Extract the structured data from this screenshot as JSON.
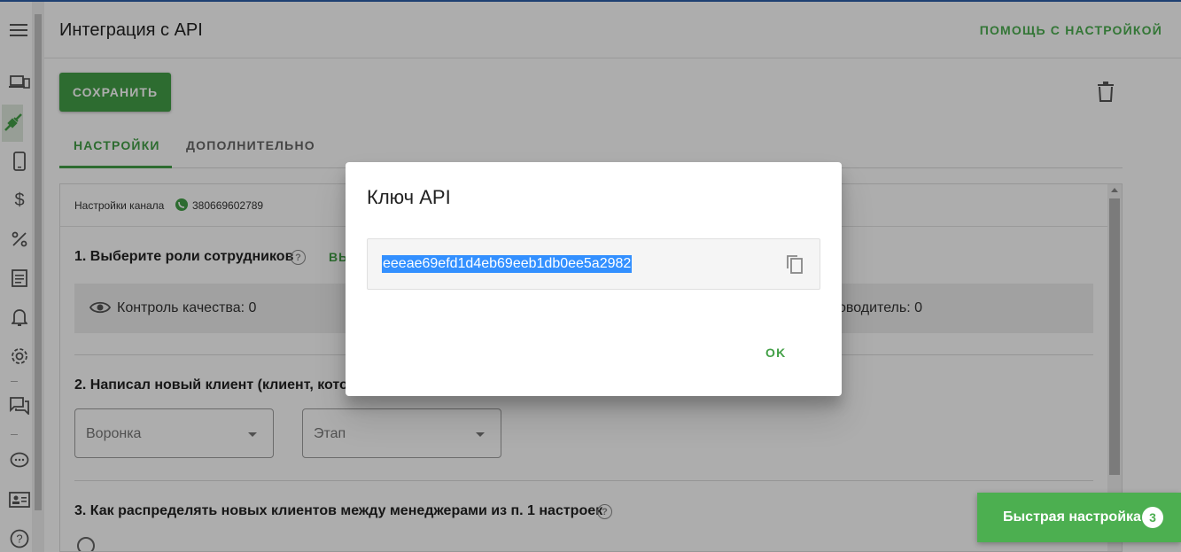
{
  "header": {
    "title": "Интеграция с API",
    "help_link": "ПОМОЩЬ С НАСТРОЙКОЙ"
  },
  "toolbar": {
    "save_label": "СОХРАНИТЬ"
  },
  "tabs": [
    {
      "label": "НАСТРОЙКИ",
      "active": true
    },
    {
      "label": "ДОПОЛНИТЕЛЬНО",
      "active": false
    }
  ],
  "panel": {
    "channel_label": "Настройки канала",
    "channel_phone": "380669602789",
    "section1_title": "1. Выберите роли сотрудников",
    "select_all": "ВЫ",
    "role_qc": "Контроль качества: 0",
    "role_mgr": "оводитель: 0",
    "section2_title": "2. Написал новый клиент (клиент, котор",
    "funnel_placeholder": "Воронка",
    "stage_placeholder": "Этап",
    "section3_title": "3. Как распределять новых клиентов между менеджерами из п. 1 настроек"
  },
  "dialog": {
    "title": "Ключ API",
    "api_key": "eeeae69efd1d4eb69eeb1db0ee5a2982",
    "ok_label": "OK"
  },
  "quick_setup": {
    "label": "Быстрая настройка",
    "badge": "3"
  },
  "colors": {
    "accent_green": "#43a047",
    "selection_blue": "#3390ff"
  },
  "sidebar": {
    "icons": [
      "menu-icon",
      "devices-icon",
      "integration-plug-icon",
      "phone-icon",
      "dollar-icon",
      "percent-icon",
      "document-icon",
      "bell-icon",
      "settings-icon",
      "forum-icon",
      "chat-bubble-icon",
      "contact-card-icon",
      "help-icon"
    ]
  }
}
